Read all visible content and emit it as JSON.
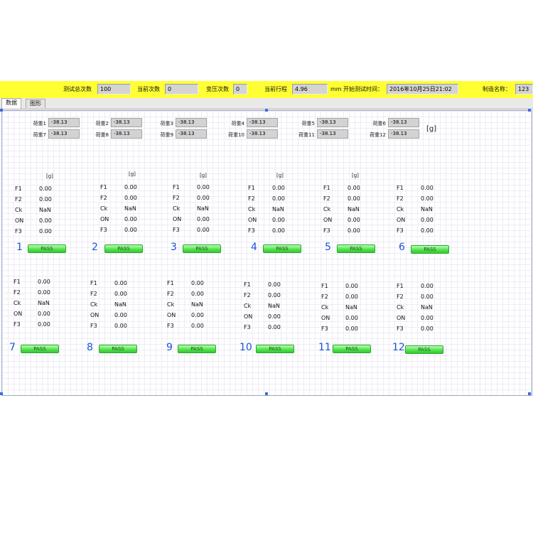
{
  "topbar": {
    "total_tests_label": "测试总次数",
    "total_tests_value": "100",
    "current_count_label": "当前次数",
    "current_count_value": "0",
    "press_count_label": "变压次数",
    "press_count_value": "0",
    "current_stroke_label": "当前行程",
    "current_stroke_value": "4.96",
    "stroke_unit": "mm",
    "start_time_label": "开始测试时间：",
    "start_time_value": "2016年10月25日21:02",
    "product_name_label": "制造名称：",
    "product_name_value": "123"
  },
  "tabs": [
    {
      "label": "数据",
      "active": true
    },
    {
      "label": "图形",
      "active": false
    }
  ],
  "loads": [
    {
      "label": "荷重1",
      "value": "-38.13"
    },
    {
      "label": "荷重2",
      "value": "-38.13"
    },
    {
      "label": "荷重3",
      "value": "-38.13"
    },
    {
      "label": "荷重4",
      "value": "-38.13"
    },
    {
      "label": "荷重5",
      "value": "-38.13"
    },
    {
      "label": "荷重6",
      "value": "-38.13"
    },
    {
      "label": "荷重7",
      "value": "-38.13"
    },
    {
      "label": "荷重8",
      "value": "-38.13"
    },
    {
      "label": "荷重9",
      "value": "-38.13"
    },
    {
      "label": "荷重10",
      "value": "-38.13"
    },
    {
      "label": "荷重11",
      "value": "-38.13"
    },
    {
      "label": "荷重12",
      "value": "-38.13"
    }
  ],
  "load_unit": "[g]",
  "groups": [
    {
      "number": "1",
      "unit": "[g]",
      "rows": [
        [
          "F1",
          "0.00"
        ],
        [
          "F2",
          "0.00"
        ],
        [
          "Ck",
          "NaN"
        ],
        [
          "ON",
          "0.00"
        ],
        [
          "F3",
          "0.00"
        ]
      ],
      "status": "PASS"
    },
    {
      "number": "2",
      "unit": "[g]",
      "rows": [
        [
          "F1",
          "0.00"
        ],
        [
          "F2",
          "0.00"
        ],
        [
          "Ck",
          "NaN"
        ],
        [
          "ON",
          "0.00"
        ],
        [
          "F3",
          "0.00"
        ]
      ],
      "status": "PASS"
    },
    {
      "number": "3",
      "unit": "[g]",
      "rows": [
        [
          "F1",
          "0.00"
        ],
        [
          "F2",
          "0.00"
        ],
        [
          "Ck",
          "NaN"
        ],
        [
          "ON",
          "0.00"
        ],
        [
          "F3",
          "0.00"
        ]
      ],
      "status": "PASS"
    },
    {
      "number": "4",
      "unit": "[g]",
      "rows": [
        [
          "F1",
          "0.00"
        ],
        [
          "F2",
          "0.00"
        ],
        [
          "Ck",
          "NaN"
        ],
        [
          "ON",
          "0.00"
        ],
        [
          "F3",
          "0.00"
        ]
      ],
      "status": "PASS"
    },
    {
      "number": "5",
      "unit": "[g]",
      "rows": [
        [
          "F1",
          "0.00"
        ],
        [
          "F2",
          "0.00"
        ],
        [
          "Ck",
          "NaN"
        ],
        [
          "ON",
          "0.00"
        ],
        [
          "F3",
          "0.00"
        ]
      ],
      "status": "PASS"
    },
    {
      "number": "6",
      "unit": "",
      "rows": [
        [
          "F1",
          "0.00"
        ],
        [
          "F2",
          "0.00"
        ],
        [
          "Ck",
          "NaN"
        ],
        [
          "ON",
          "0.00"
        ],
        [
          "F3",
          "0.00"
        ]
      ],
      "status": "PASS"
    },
    {
      "number": "7",
      "unit": "",
      "rows": [
        [
          "F1",
          "0.00"
        ],
        [
          "F2",
          "0.00"
        ],
        [
          "Ck",
          "NaN"
        ],
        [
          "ON",
          "0.00"
        ],
        [
          "F3",
          "0.00"
        ]
      ],
      "status": "PASS"
    },
    {
      "number": "8",
      "unit": "",
      "rows": [
        [
          "F1",
          "0.00"
        ],
        [
          "F2",
          "0.00"
        ],
        [
          "Ck",
          "NaN"
        ],
        [
          "ON",
          "0.00"
        ],
        [
          "F3",
          "0.00"
        ]
      ],
      "status": "PASS"
    },
    {
      "number": "9",
      "unit": "",
      "rows": [
        [
          "F1",
          "0.00"
        ],
        [
          "F2",
          "0.00"
        ],
        [
          "Ck",
          "NaN"
        ],
        [
          "ON",
          "0.00"
        ],
        [
          "F3",
          "0.00"
        ]
      ],
      "status": "PASS"
    },
    {
      "number": "10",
      "unit": "",
      "rows": [
        [
          "F1",
          "0.00"
        ],
        [
          "F2",
          "0.00"
        ],
        [
          "Ck",
          "NaN"
        ],
        [
          "ON",
          "0.00"
        ],
        [
          "F3",
          "0.00"
        ]
      ],
      "status": "PASS"
    },
    {
      "number": "11",
      "unit": "",
      "rows": [
        [
          "F1",
          "0.00"
        ],
        [
          "F2",
          "0.00"
        ],
        [
          "Ck",
          "NaN"
        ],
        [
          "ON",
          "0.00"
        ],
        [
          "F3",
          "0.00"
        ]
      ],
      "status": "PASS"
    },
    {
      "number": "12",
      "unit": "",
      "rows": [
        [
          "F1",
          "0.00"
        ],
        [
          "F2",
          "0.00"
        ],
        [
          "Ck",
          "NaN"
        ],
        [
          "ON",
          "0.00"
        ],
        [
          "F3",
          "0.00"
        ]
      ],
      "status": "PASS"
    }
  ],
  "colors": {
    "topbar_bg": "#ffff33",
    "pass_green": "#4fe04a",
    "group_number_blue": "#1a53d6"
  }
}
